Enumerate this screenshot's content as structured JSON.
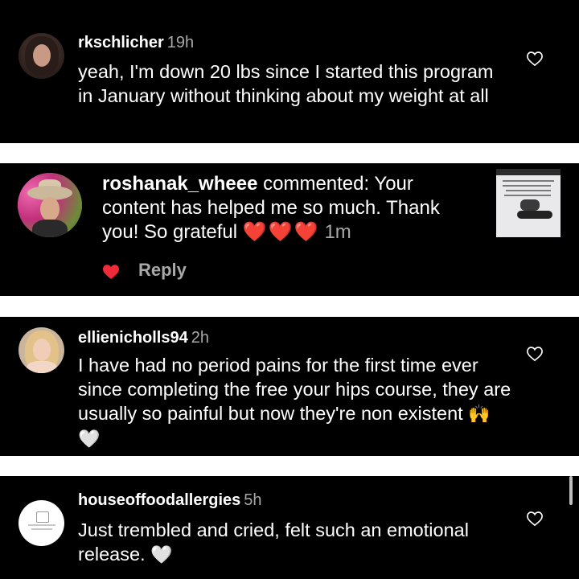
{
  "comments": [
    {
      "username": "rkschlicher",
      "time": "19h",
      "text": "yeah, I'm down 20 lbs since I started this program in January without thinking about my weight at all",
      "avatar_icon": "profile-photo-woman-dark-hair",
      "like_icon": "heart-outline-icon"
    },
    {
      "username": "ellienicholls94",
      "time": "2h",
      "text_main": "I have had no period pains for the first time ever since completing the free your hips course, they are usually so painful but now they're non existent",
      "emoji": "🙌🤍",
      "avatar_icon": "profile-photo-woman-blonde",
      "like_icon": "heart-outline-icon"
    },
    {
      "username": "houseoffoodallergies",
      "time": "5h",
      "text_main": "Just trembled and cried, felt such an emotional release.",
      "emoji": "🤍",
      "avatar_icon": "brand-logo",
      "like_icon": "heart-outline-icon"
    }
  ],
  "notification": {
    "username": "roshanak_wheee",
    "action": "commented:",
    "text": "Your content has helped me so much. Thank you! So grateful",
    "hearts": "❤️❤️❤️",
    "time": "1m",
    "reply_label": "Reply",
    "avatar_icon": "profile-photo-woman-hat",
    "thumbnail_icon": "post-thumbnail",
    "like_icon": "heart-filled-icon"
  },
  "colors": {
    "card_bg": "#000000",
    "separator": "#ffffff",
    "muted_text": "#a8a8a8",
    "like_red": "#ef2b3a"
  }
}
